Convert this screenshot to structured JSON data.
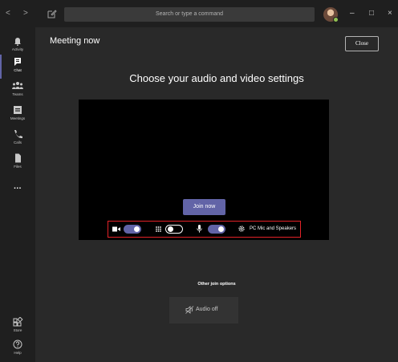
{
  "topbar": {
    "back": "<",
    "forward": ">",
    "search_placeholder": "Search or type a command",
    "min": "–",
    "max": "□",
    "close": "×"
  },
  "sidebar": {
    "items": [
      {
        "label": "Activity",
        "icon": "bell-icon"
      },
      {
        "label": "Chat",
        "icon": "chat-icon"
      },
      {
        "label": "Teams",
        "icon": "teams-icon"
      },
      {
        "label": "Meetings",
        "icon": "calendar-icon"
      },
      {
        "label": "Calls",
        "icon": "phone-icon"
      },
      {
        "label": "Files",
        "icon": "file-icon"
      }
    ],
    "more": "...",
    "bottom": [
      {
        "label": "Store",
        "icon": "store-icon"
      },
      {
        "label": "Help",
        "icon": "help-icon"
      }
    ],
    "active_index": 1
  },
  "meeting": {
    "title": "Meeting now",
    "close_label": "Close",
    "heading": "Choose your audio and video settings",
    "join_label": "Join now",
    "camera_on": true,
    "blur_on": false,
    "mic_on": true,
    "device_label": "PC Mic and Speakers",
    "other_options_label": "Other join options",
    "audio_off_label": "Audio off"
  },
  "colors": {
    "accent": "#6264a7",
    "background": "#292929",
    "rail": "#1f1f1f",
    "highlight_border": "#e32228"
  }
}
